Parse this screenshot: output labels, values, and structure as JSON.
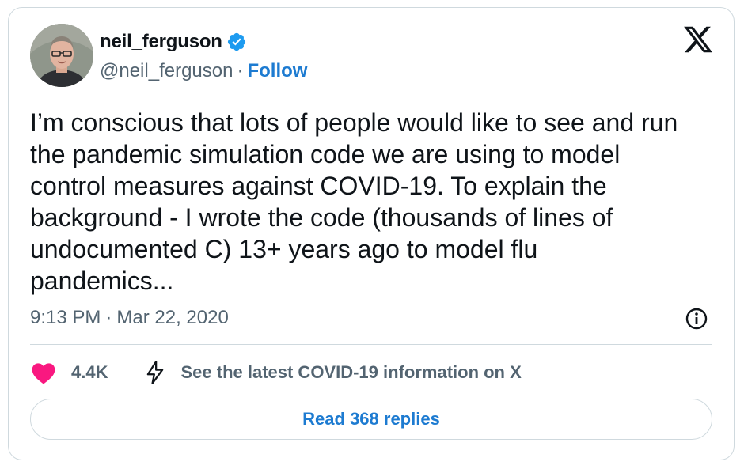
{
  "author": {
    "display_name": "neil_ferguson",
    "handle": "@neil_ferguson",
    "separator": "·",
    "follow_label": "Follow",
    "verified_color": "#1d9bf0"
  },
  "tweet": {
    "text": "I’m conscious that lots of people would like to see and run\nthe pandemic simulation code we are using to model\ncontrol measures against COVID-19.  To explain the\nbackground - I wrote the code (thousands of lines of\nundocumented C) 13+ years ago to model flu\npandemics...",
    "time": "9:13 PM",
    "separator": "·",
    "date": "Mar 22, 2020"
  },
  "actions": {
    "like_count": "4.4K",
    "covid_info_label": "See the latest COVID-19 information on X",
    "replies_label": "Read 368 replies"
  },
  "colors": {
    "heart": "#f91880",
    "link": "#1d7bd1",
    "muted": "#536471"
  },
  "icons": [
    "verified-badge-icon",
    "x-logo-icon",
    "info-icon",
    "heart-icon",
    "lightning-bolt-icon"
  ]
}
